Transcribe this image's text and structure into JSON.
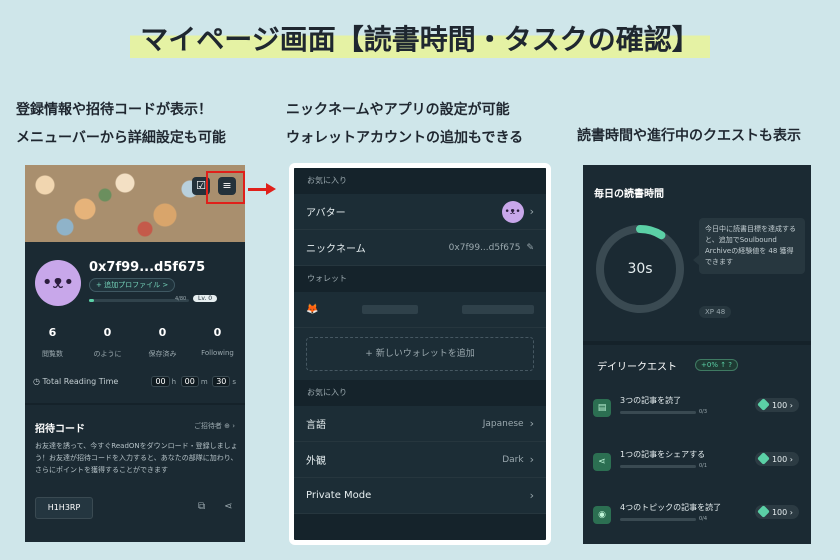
{
  "title": "マイページ画面【読書時間・タスクの確認】",
  "captions": {
    "left": [
      "登録情報や招待コードが表示！",
      "メニューバーから詳細設定も可能"
    ],
    "middle": [
      "ニックネームやアプリの設定が可能",
      "ウォレットアカウントの追加もできる"
    ],
    "right": [
      "読書時間や進行中のクエストも表示"
    ]
  },
  "profile": {
    "address": "0x7f99...d5f675",
    "add_profile": "+ 追加プロファイル >",
    "xp": "4/80",
    "xp_ratio": 0.05,
    "level": "Lv. 0",
    "stats": [
      {
        "value": "6",
        "label": "閲覧数"
      },
      {
        "value": "0",
        "label": "のように"
      },
      {
        "value": "0",
        "label": "保存済み"
      },
      {
        "value": "0",
        "label": "Following"
      }
    ],
    "total_reading_label": "Total Reading Time",
    "time": {
      "h": "00",
      "h_unit": "h",
      "m": "00",
      "m_unit": "m",
      "s": "30",
      "s_unit": "s"
    },
    "invite": {
      "title": "招待コード",
      "inviter": "ご招待者 ⊕ ›",
      "description": "お友達を誘って、今すぐReadONをダウンロード・登録しましょう！お友達が招待コードを入力すると、あなたの部隊に加わり、さらにポイントを獲得することができます",
      "code": "H1H3RP"
    }
  },
  "settings": {
    "sections": [
      "お気に入り",
      "ウォレット",
      "お気に入り"
    ],
    "avatar_label": "アバター",
    "nickname_label": "ニックネーム",
    "nickname_value": "0x7f99...d5f675",
    "add_wallet": "+ 新しいウォレットを追加",
    "language_label": "言語",
    "language_value": "Japanese",
    "appearance_label": "外観",
    "appearance_value": "Dark",
    "private_label": "Private Mode"
  },
  "reading": {
    "title": "毎日の読書時間",
    "seconds": "30s",
    "progress": 0.09,
    "tip": "今日中に読書目標を達成すると、追加でSoulbound Archiveの経験値を 48 獲得できます",
    "xp": "48",
    "daily_quest": "デイリークエスト",
    "badge": "+0% ↑ ?",
    "quests": [
      {
        "name": "3つの記事を読了",
        "progress": "0/3",
        "points": "100"
      },
      {
        "name": "1つの記事をシェアする",
        "progress": "0/1",
        "points": "100"
      },
      {
        "name": "4つのトピックの記事を読了",
        "progress": "0/4",
        "points": "100"
      }
    ]
  },
  "colors": {
    "accent": "#5bd0a6",
    "highlight": "#e0201a",
    "panel": "#1b2a33"
  }
}
